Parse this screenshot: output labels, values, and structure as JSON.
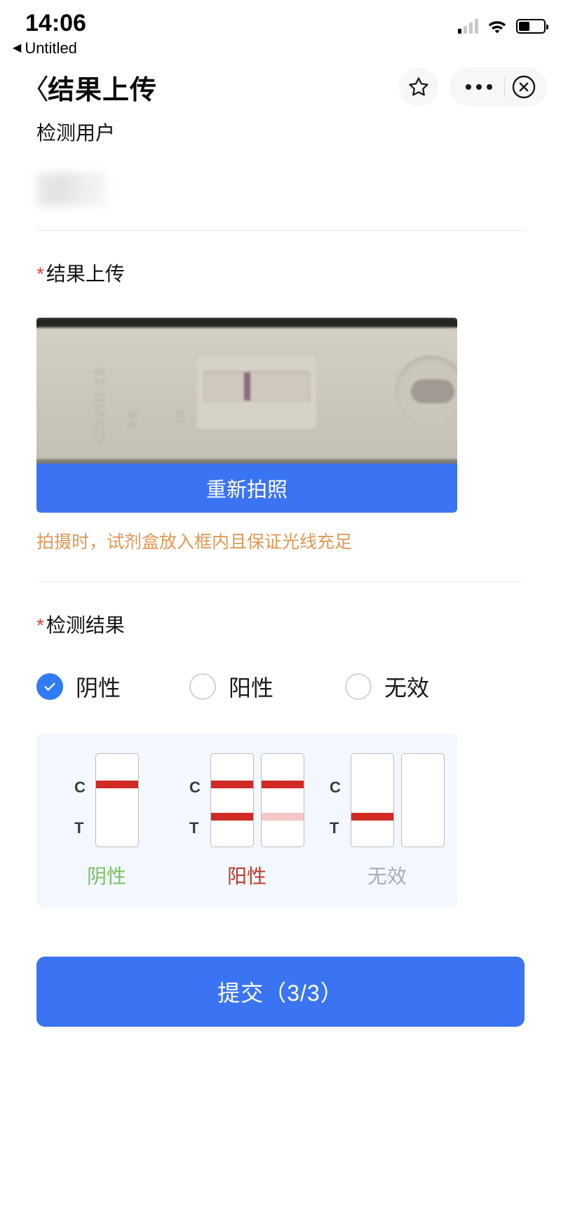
{
  "status_bar": {
    "time": "14:06",
    "back_app_label": "Untitled",
    "back_app_arrow": "◀",
    "signal_icon": "cellular-signal-icon",
    "wifi_icon": "wifi-icon",
    "battery_icon": "battery-icon",
    "battery_level_percent": 45
  },
  "nav": {
    "back_icon": "〈",
    "title": "结果上传",
    "star_icon": "star-icon",
    "more_icon": "more-options-icon",
    "close_icon": "close-icon"
  },
  "form": {
    "user_section": {
      "label": "检测用户",
      "value": "",
      "redacted": true
    },
    "upload_section": {
      "required_mark": "*",
      "label": "结果上传",
      "photo_alt": "covid-19-antigen-test-cassette-photo",
      "retake_label": "重新拍照",
      "hint": "拍摄时，试剂盒放入框内且保证光线充足"
    },
    "result_section": {
      "required_mark": "*",
      "label": "检测结果",
      "options": [
        {
          "label": "阴性",
          "selected": true
        },
        {
          "label": "阳性",
          "selected": false
        },
        {
          "label": "无效",
          "selected": false
        }
      ]
    },
    "legend": {
      "c_label": "C",
      "t_label": "T",
      "items": [
        {
          "caption": "阴性",
          "color": "#7bc062"
        },
        {
          "caption": "阳性",
          "color": "#c0392b"
        },
        {
          "caption": "无效",
          "color": "#a8aeb4"
        }
      ]
    },
    "submit": {
      "label": "提交（3/3）",
      "current_step": 3,
      "total_steps": 3
    }
  },
  "colors": {
    "primary_blue": "#3b74f2",
    "radio_blue": "#2f7cf6",
    "required_red": "#e8453c",
    "hint_orange": "#e39753",
    "band_red": "#cf2a24",
    "band_faint": "#f3c8c6",
    "legend_bg": "#f2f8fd"
  }
}
